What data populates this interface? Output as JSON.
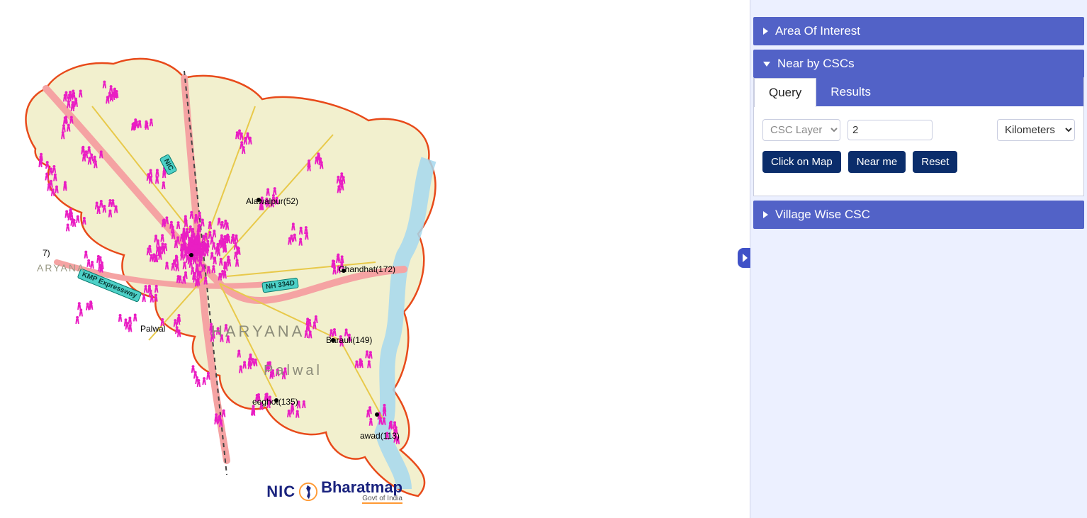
{
  "sidebar": {
    "accordion1": {
      "title": "Area Of Interest"
    },
    "accordion2": {
      "title": "Near by CSCs",
      "tabs": {
        "query": "Query",
        "results": "Results"
      },
      "layer_select": {
        "label": "CSC Layer",
        "options": [
          "CSC Layer"
        ]
      },
      "distance_value": "2",
      "unit_select": {
        "label": "Kilometers",
        "options": [
          "Kilometers"
        ]
      },
      "btn_click_map": "Click on Map",
      "btn_near_me": "Near me",
      "btn_reset": "Reset"
    },
    "accordion3": {
      "title": "Village Wise CSC"
    }
  },
  "map": {
    "state_label_big1": "HARYANA",
    "state_label_big2": "Palwal",
    "state_label_left": "ARYANA",
    "places": {
      "alawalpur": "Alawalpur(52)",
      "chandhat": "Chandhat(172)",
      "barauli": "Barauli(149)",
      "palwal_small": "Palwal",
      "deeghot": "eeghot(135)",
      "bhiduki": "",
      "jawad": "awad(113)",
      "seven": "7)"
    },
    "roads": {
      "nh334d": "NH 334D",
      "kmp": "KMP Expressway",
      "nic_road": "NIC"
    }
  },
  "logo": {
    "nic": "NIC",
    "bharat": "Bharatmap",
    "sub": "Govt of India"
  }
}
